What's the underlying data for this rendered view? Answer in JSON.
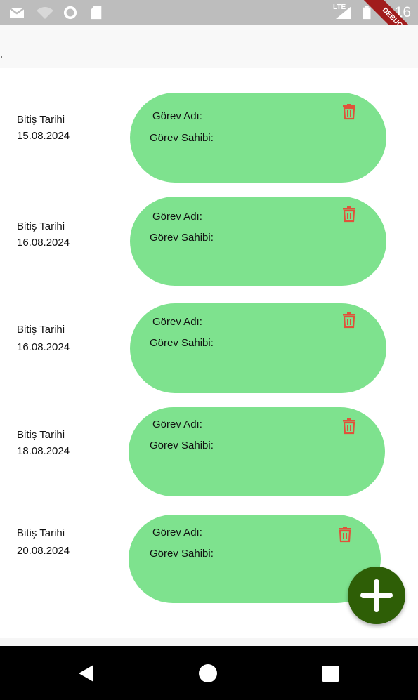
{
  "status_bar": {
    "time": "3:16",
    "network_label": "LTE",
    "icons": [
      "gmail-icon",
      "wifi-icon",
      "circle-status-icon",
      "sd-card-icon",
      "signal-icon",
      "battery-icon"
    ],
    "debug_banner": "DEBUG"
  },
  "tasks": [
    {
      "date_label": "Bitiş Tarihi",
      "date": "15.08.2024",
      "name_label": "Görev Adı:",
      "owner_label": "Görev Sahibi:"
    },
    {
      "date_label": "Bitiş Tarihi",
      "date": "16.08.2024",
      "name_label": "Görev Adı:",
      "owner_label": "Görev Sahibi:"
    },
    {
      "date_label": "Bitiş Tarihi",
      "date": "16.08.2024",
      "name_label": "Görev Adı:",
      "owner_label": "Görev Sahibi:"
    },
    {
      "date_label": "Bitiş Tarihi",
      "date": "18.08.2024",
      "name_label": "Görev Adı:",
      "owner_label": "Görev Sahibi:"
    },
    {
      "date_label": "Bitiş Tarihi",
      "date": "20.08.2024",
      "name_label": "Görev Adı:",
      "owner_label": "Görev Sahibi:"
    }
  ],
  "fab": {
    "icon": "plus-icon"
  },
  "nav": {
    "icons": [
      "back-icon",
      "home-icon",
      "recents-icon"
    ]
  },
  "colors": {
    "card": "#7ee28e",
    "trash": "#e0523a",
    "fab": "#2e5e06",
    "status_bar": "#bdbdbd",
    "nav_bar": "#000000"
  }
}
